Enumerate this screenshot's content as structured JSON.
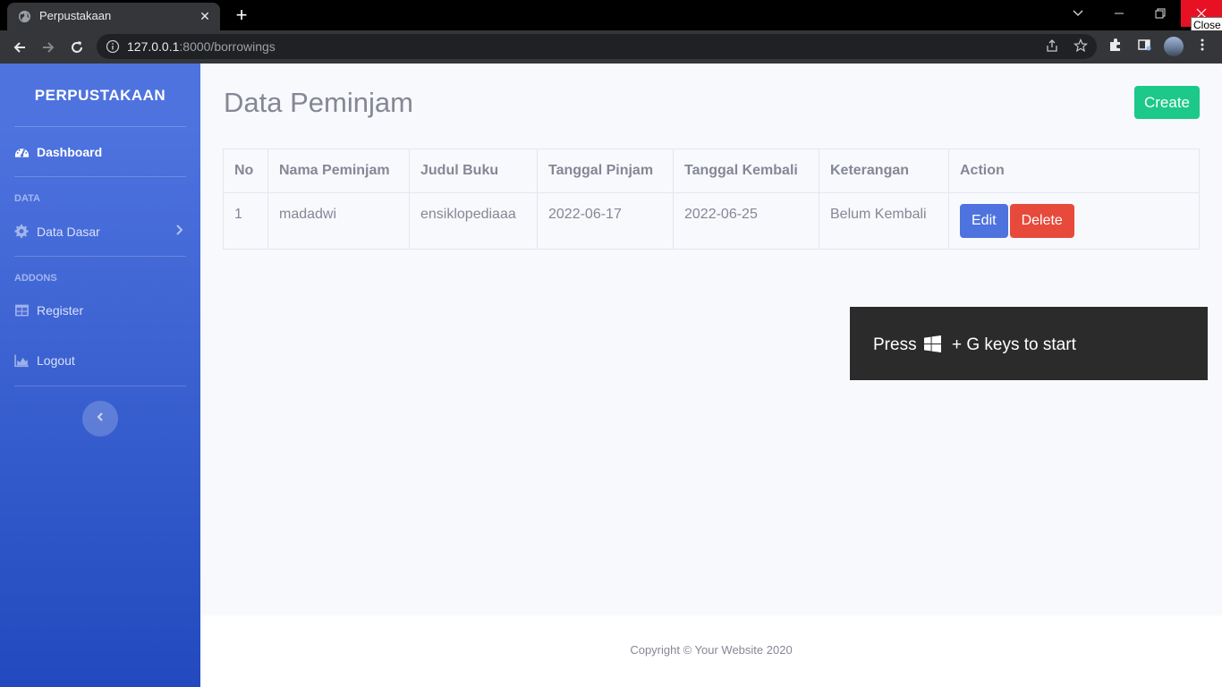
{
  "browser": {
    "tab_title": "Perpustakaan",
    "tab_close": "✕",
    "new_tab": "+",
    "url_host": "127.0.0.1",
    "url_rest": ":8000/borrowings",
    "close_tooltip": "Close",
    "icons": [
      "back-arrow-icon",
      "forward-arrow-icon",
      "reload-icon",
      "info-icon",
      "share-icon",
      "star-icon",
      "extensions-icon",
      "side-panel-icon",
      "profile-avatar",
      "kebab-menu-icon"
    ]
  },
  "sidebar": {
    "brand": "PERPUSTAKAAN",
    "items": [
      {
        "label": "Dashboard",
        "icon": "tachometer-icon"
      },
      {
        "heading": "DATA"
      },
      {
        "label": "Data Dasar",
        "icon": "cog-icon"
      },
      {
        "heading": "ADDONS"
      },
      {
        "label": "Register",
        "icon": "table-icon"
      },
      {
        "label": "Logout",
        "icon": "area-chart-icon"
      }
    ],
    "toggle_icon": "‹"
  },
  "main": {
    "title": "Data Peminjam",
    "create_label": "Create",
    "table": {
      "headers": [
        "No",
        "Nama Peminjam",
        "Judul Buku",
        "Tanggal Pinjam",
        "Tanggal Kembali",
        "Keterangan",
        "Action"
      ],
      "rows": [
        {
          "no": "1",
          "nama": "madadwi",
          "judul": "ensiklopediaaa",
          "pinjam": "2022-06-17",
          "kembali": "2022-06-25",
          "keterangan": "Belum Kembali",
          "edit": "Edit",
          "delete": "Delete"
        }
      ]
    }
  },
  "gamebar": {
    "press": "Press",
    "rest": "+ G keys to start"
  },
  "footer": {
    "text": "Copyright © Your Website 2020"
  },
  "colors": {
    "sidebar_top": "#4e73df",
    "sidebar_bottom": "#224abe",
    "success": "#1cc88a",
    "primary": "#4e73df",
    "danger": "#e74a3b",
    "text_gray": "#858796"
  }
}
